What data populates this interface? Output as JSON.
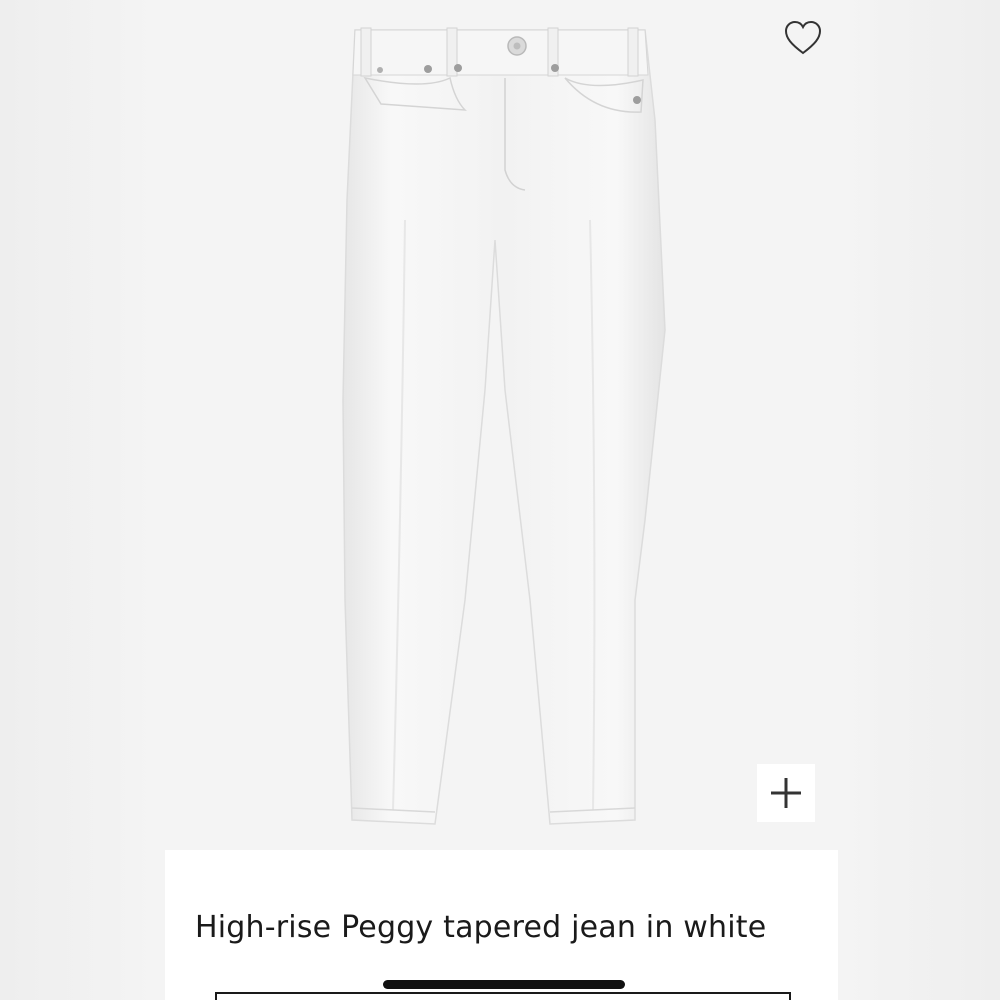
{
  "product": {
    "title": "High-rise Peggy tapered jean in white",
    "image_alt": "High-rise Peggy tapered jean in white",
    "garment_color": "#f7f7f7"
  },
  "actions": {
    "wishlist_icon": "heart-outline-icon",
    "zoom_icon": "plus-icon"
  },
  "colors": {
    "image_background": "#f4f4f4",
    "text": "#1a1a1a",
    "icon": "#333333"
  }
}
